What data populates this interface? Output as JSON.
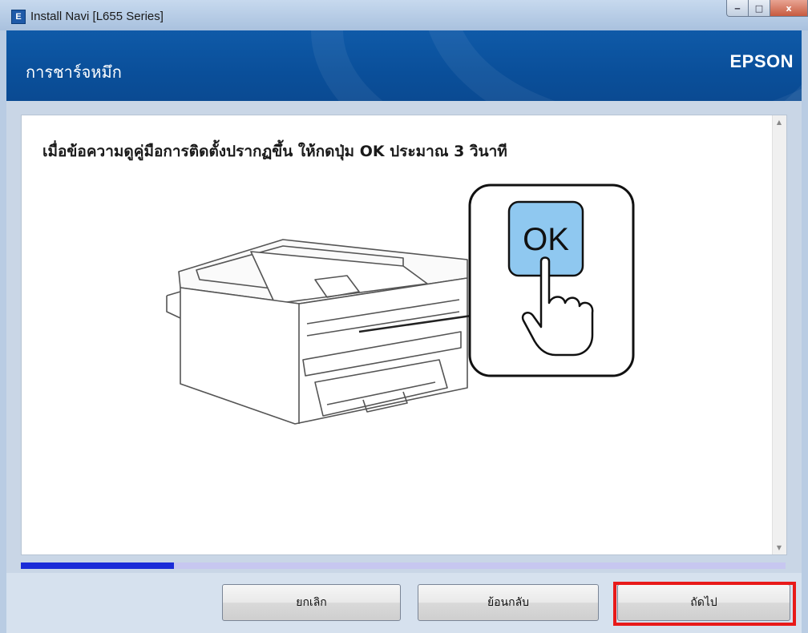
{
  "window": {
    "title": "Install Navi [L655 Series]",
    "icon_letter": "E",
    "controls": {
      "minimize": "‒",
      "maximize": "□",
      "close": "x"
    }
  },
  "header": {
    "title": "การชาร์จหมึก",
    "brand": "EPSON"
  },
  "content": {
    "instruction": "เมื่อข้อความดูคู่มือการติดตั้งปรากฏขึ้น ให้กดปุ่ม OK ประมาณ 3 วินาที",
    "ok_label": "OK"
  },
  "progress": {
    "value": 0.2
  },
  "buttons": {
    "cancel": "ยกเลิก",
    "back": "ย้อนกลับ",
    "next": "ถัดไป"
  },
  "colors": {
    "header_bg": "#0a4f9a",
    "progress_fill": "#1a2bd8",
    "highlight": "#e81a1a",
    "ok_button": "#8fc8f0"
  },
  "icons": [
    "installer-app-icon",
    "minimize-icon",
    "maximize-icon",
    "close-icon",
    "scroll-up-icon",
    "scroll-down-icon",
    "printer-illustration",
    "hand-pointer-icon"
  ]
}
